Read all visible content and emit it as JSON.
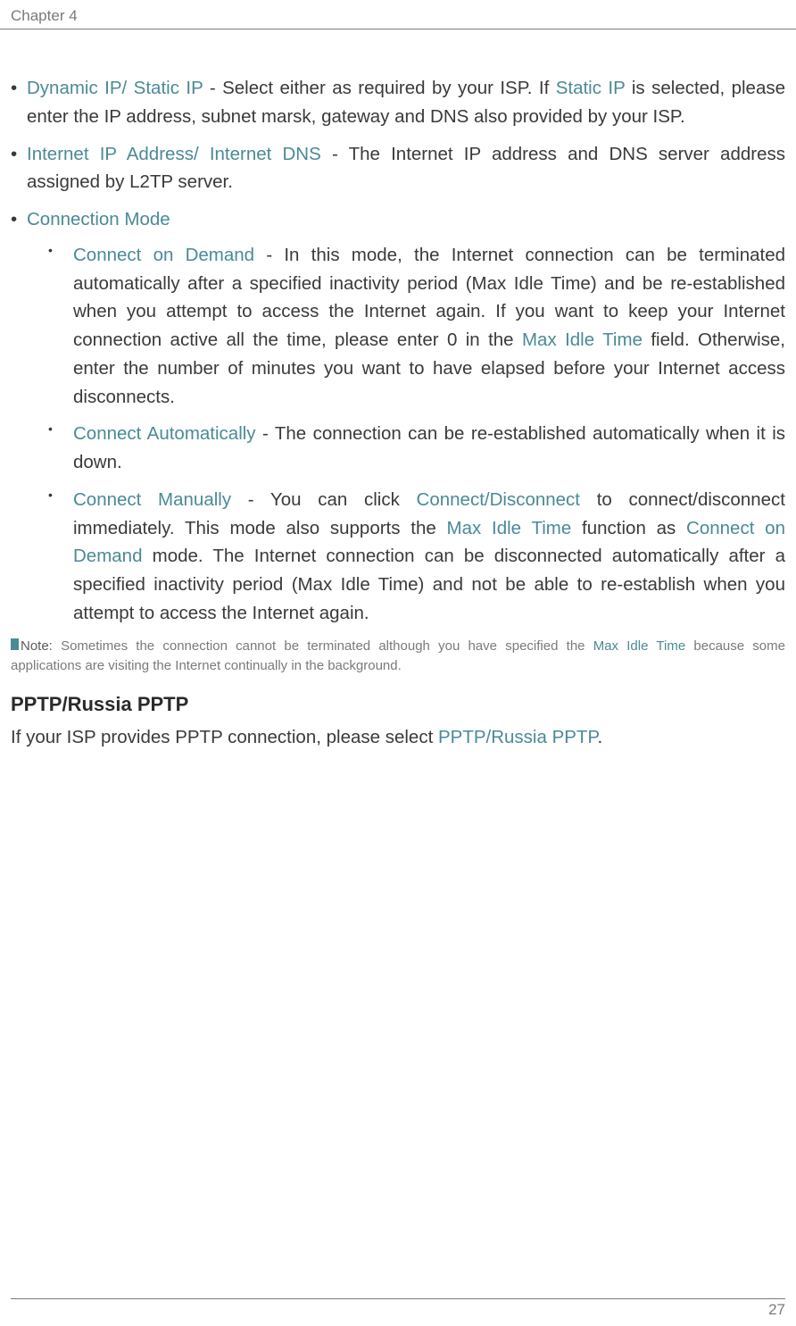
{
  "header": {
    "chapter": "Chapter 4"
  },
  "items": {
    "dynamic_static": {
      "term": "Dynamic IP/ Static IP",
      "text1": " - Select either as required by your ISP.  If ",
      "term2": "Static IP",
      "text2": " is selected, please enter the IP address, subnet marsk, gateway and DNS also provided by your ISP."
    },
    "internet_ip": {
      "term": "Internet IP Address/ Internet DNS",
      "text": " - The Internet IP address and DNS server address assigned by L2TP server."
    },
    "connection_mode": {
      "term": "Connection Mode"
    },
    "connect_demand": {
      "term": "Connect on Demand",
      "text1": " - In this mode, the Internet connection can be terminated automatically after a specified inactivity period (Max Idle Time) and be re-established when you attempt to access the Internet again. If you want to keep your Internet connection active all the time, please enter 0 in the ",
      "term2": "Max Idle Time",
      "text2": " field. Otherwise, enter the number of minutes you want to have elapsed before your Internet access disconnects."
    },
    "connect_auto": {
      "term": "Connect Automatically",
      "text": " - The connection can be re-established automatically when it is down."
    },
    "connect_manual": {
      "term": "Connect Manually",
      "text1": " - You can click ",
      "term2": "Connect/Disconnect",
      "text2": " to connect/disconnect immediately. This mode also supports the ",
      "term3": "Max Idle Time",
      "text3": " function as ",
      "term4": "Connect on Demand",
      "text4": " mode. The Internet connection can be disconnected automatically after a specified inactivity period (Max Idle Time) and not be able to re-establish when you attempt to access the Internet again."
    }
  },
  "note": {
    "label": "Note:",
    "text1": " Sometimes the connection cannot be terminated although you have specified the ",
    "term": "Max Idle Time",
    "text2": " because some applications are visiting the Internet continually in the background."
  },
  "section": {
    "title": "PPTP/Russia PPTP",
    "text1": "If your ISP provides PPTP connection, please select ",
    "term": "PPTP/Russia PPTP",
    "text2": "."
  },
  "footer": {
    "page": "27"
  }
}
